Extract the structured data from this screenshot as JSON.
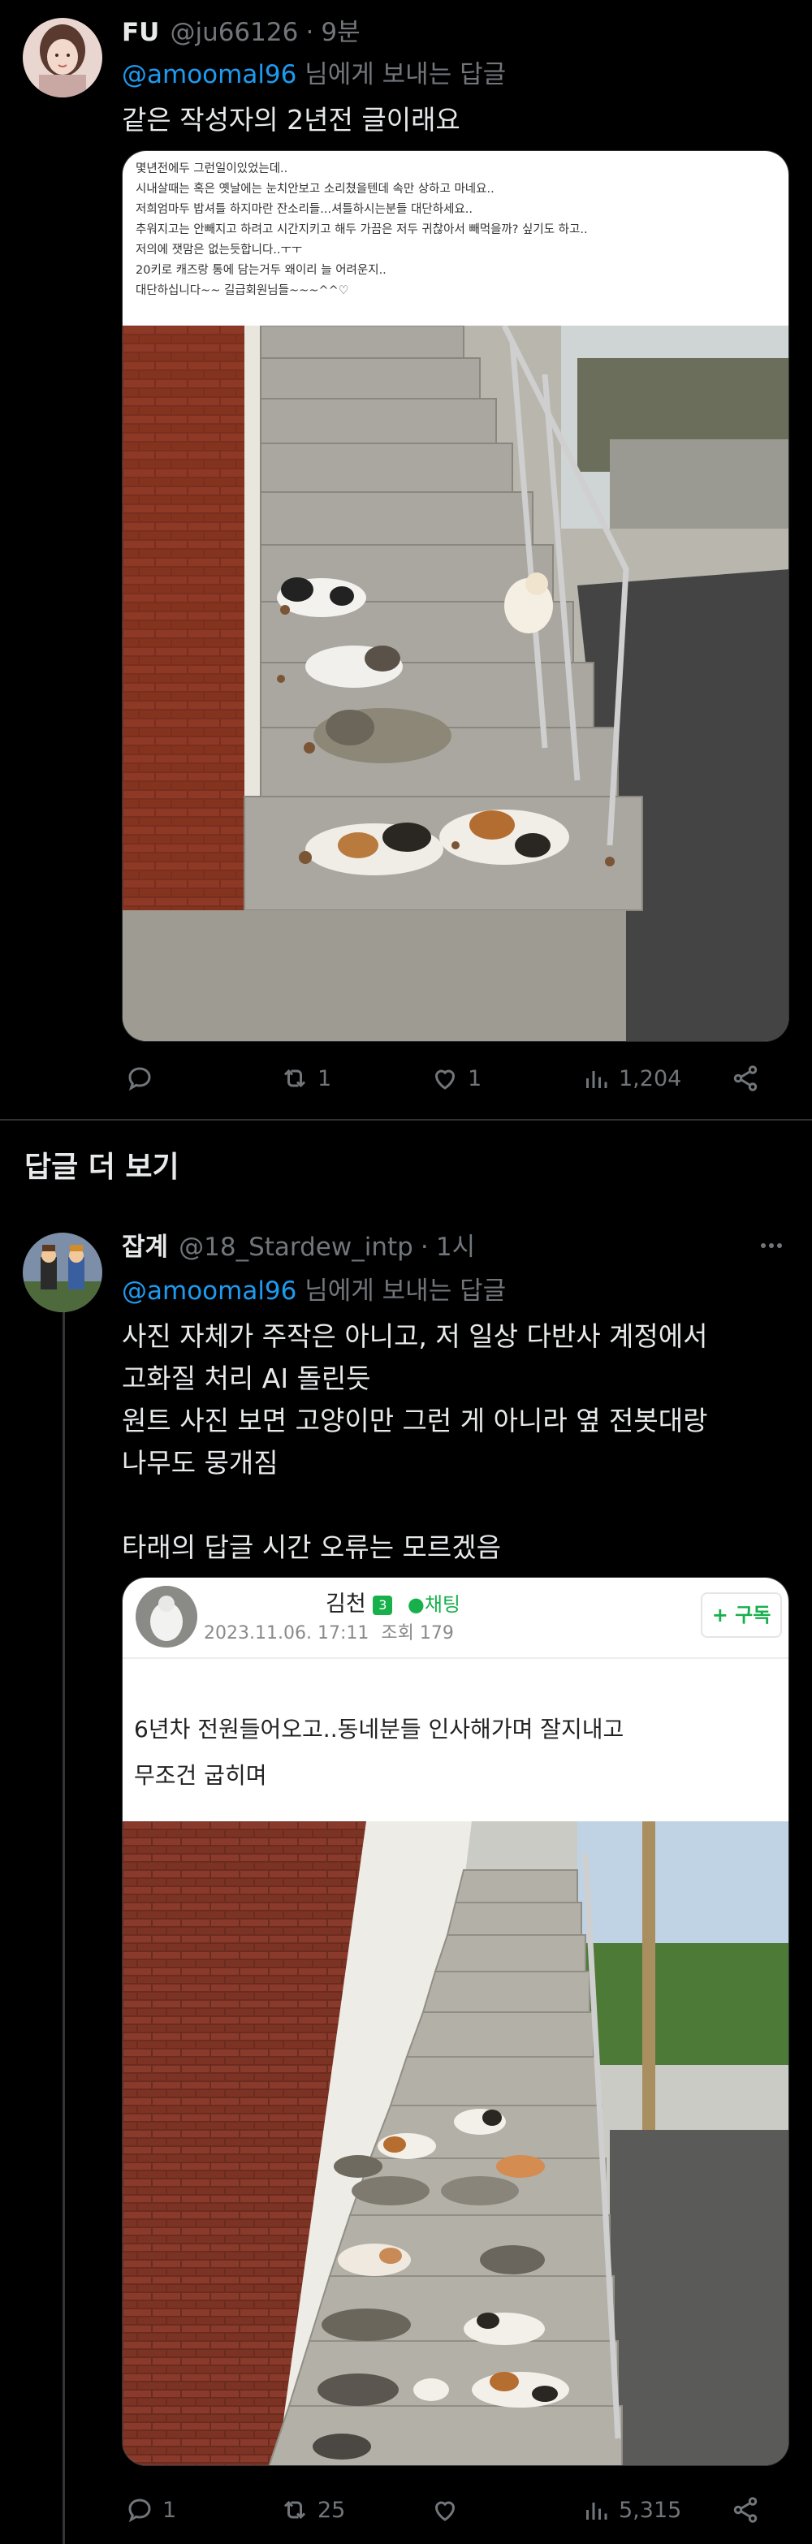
{
  "tweet1": {
    "display_name": "FU",
    "handle": "@ju66126",
    "dot": "·",
    "time": "9분",
    "replying_mention": "@amoomal96",
    "replying_suffix": " 님에게 보내는 답글",
    "text": "같은 작성자의 2년전 글이래요",
    "image_text_lines": [
      "몇년전에두 그런일이있었는데..",
      "시내살때는 혹은 옛날에는 눈치안보고 소리쳤을텐데 속만 상하고 마네요..",
      "저희엄마두 밥셔틀 하지마란 잔소리들...셔틀하시는분들 대단하세요..",
      "추워지고는 안빼지고 하려고 시간지키고 해두 가끔은 저두 귀찮아서 빼먹을까? 싶기도 하고..",
      "저의에 잿맘은 없는듯합니다..ㅜㅜ",
      "20키로 캐즈랑 통에 담는거두 왜이리 늘 어려운지..",
      "대단하십니다~~ 길급회원님들~~~^^♡"
    ],
    "actions": {
      "reply": "",
      "retweet": "1",
      "like": "1",
      "views": "1,204"
    }
  },
  "section_title": "답글 더 보기",
  "tweet2": {
    "display_name": "잡계",
    "handle": "@18_Stardew_intp",
    "dot": "·",
    "time": "1시",
    "replying_mention": "@amoomal96",
    "replying_suffix": " 님에게 보내는 답글",
    "text": "사진 자체가 주작은 아니고, 저 일상 다반사 계정에서\n고화질 처리 AI 돌린듯\n원트 사진 보면 고양이만 그런 게 아니라 옆 전봇대랑\n나무도 뭉개짐\n\n타래의 답글 시간 오류는 모르겠음",
    "post": {
      "author": "김천",
      "level_badge": "3",
      "chat_label": "채팅",
      "date": "2023.11.06. 17:11",
      "views_label": "조회 179",
      "subscribe_label": "+ 구독",
      "line1": "6년차 전원들어오고..동네분들 인사해가며 잘지내고",
      "line2": "무조건 굽히며"
    },
    "actions": {
      "reply": "1",
      "retweet": "25",
      "like": "",
      "views": "5,315"
    }
  },
  "colors": {
    "background": "#000000",
    "text": "#e7e9ea",
    "muted": "#71767b",
    "accent": "#1d9bf0",
    "divider": "#2f3336"
  }
}
